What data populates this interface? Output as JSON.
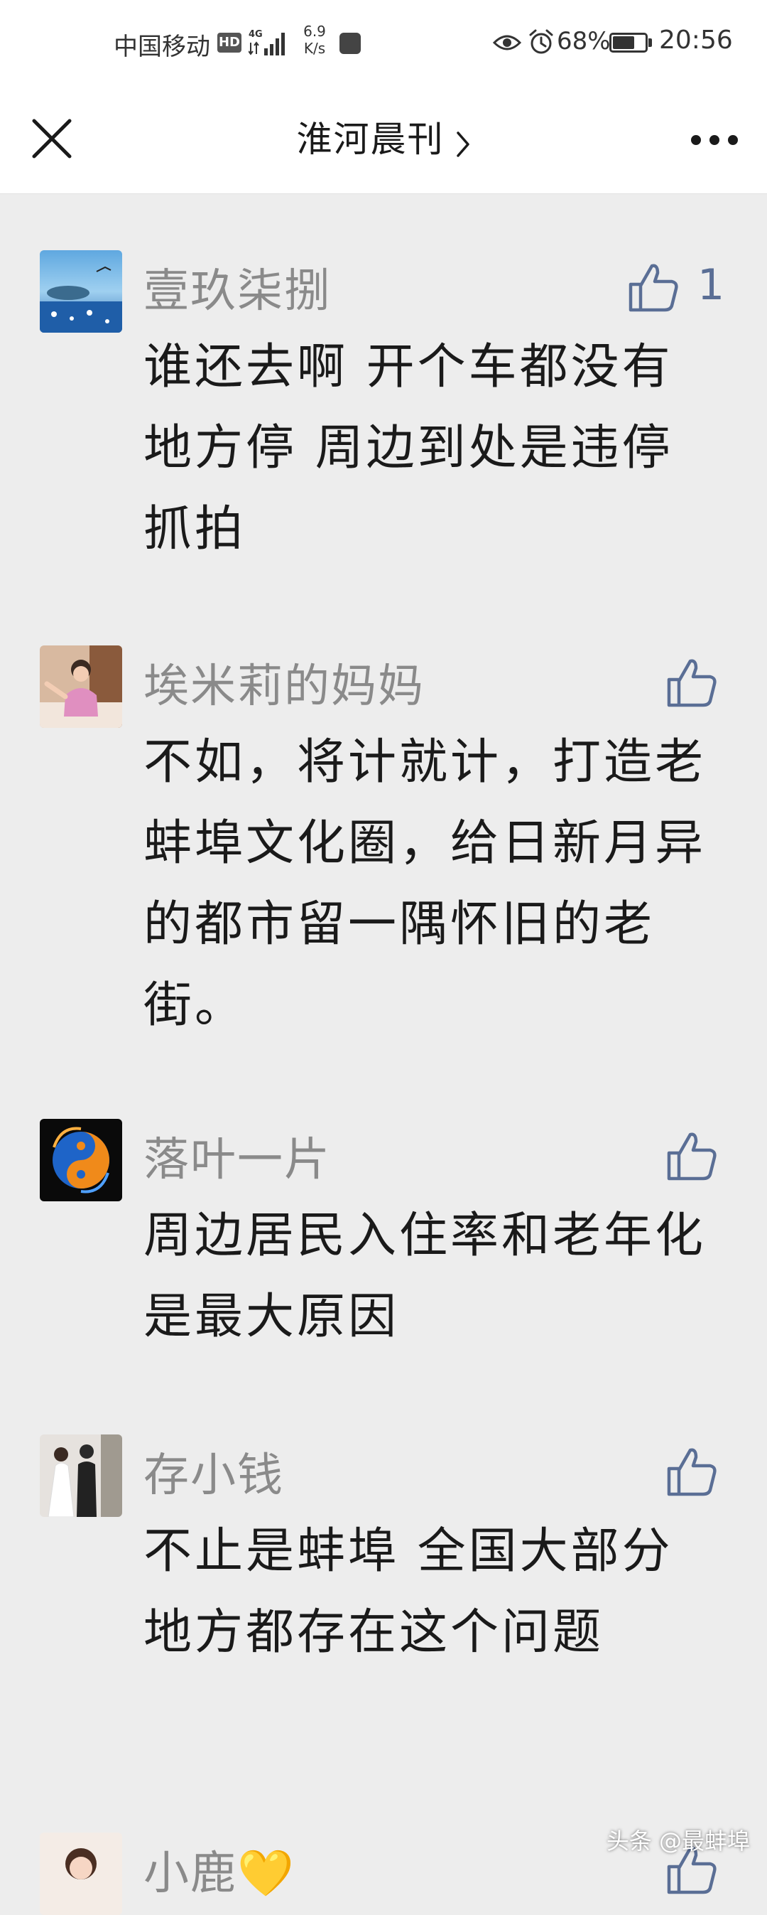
{
  "status_bar": {
    "carrier": "中国移动",
    "hd": "HD",
    "network": "4G",
    "speed_value": "6.9",
    "speed_unit": "K/s",
    "battery_percent": "68%",
    "battery_level": 0.68,
    "time": "20:56"
  },
  "nav": {
    "title": "淮河晨刊"
  },
  "comments": [
    {
      "nickname": "壹玖柒捌",
      "text": "谁还去啊  开个车都没有地方停  周边到处是违停抓拍",
      "likes": "1"
    },
    {
      "nickname": "埃米莉的妈妈",
      "text": "不如，将计就计，打造老蚌埠文化圈，给日新月异的都市留一隅怀旧的老街。",
      "likes": ""
    },
    {
      "nickname": "落叶一片",
      "text": "周边居民入住率和老年化是最大原因",
      "likes": ""
    },
    {
      "nickname": "存小钱",
      "text": "不止是蚌埠 全国大部分地方都存在这个问题",
      "likes": ""
    },
    {
      "nickname": "小鹿💛",
      "text": "",
      "likes": ""
    }
  ],
  "watermark": "头条 @最蚌埠",
  "colors": {
    "background": "#ededed",
    "nickname": "#8a8a8a",
    "like": "#5a6e95",
    "text": "#1a1a1a"
  }
}
